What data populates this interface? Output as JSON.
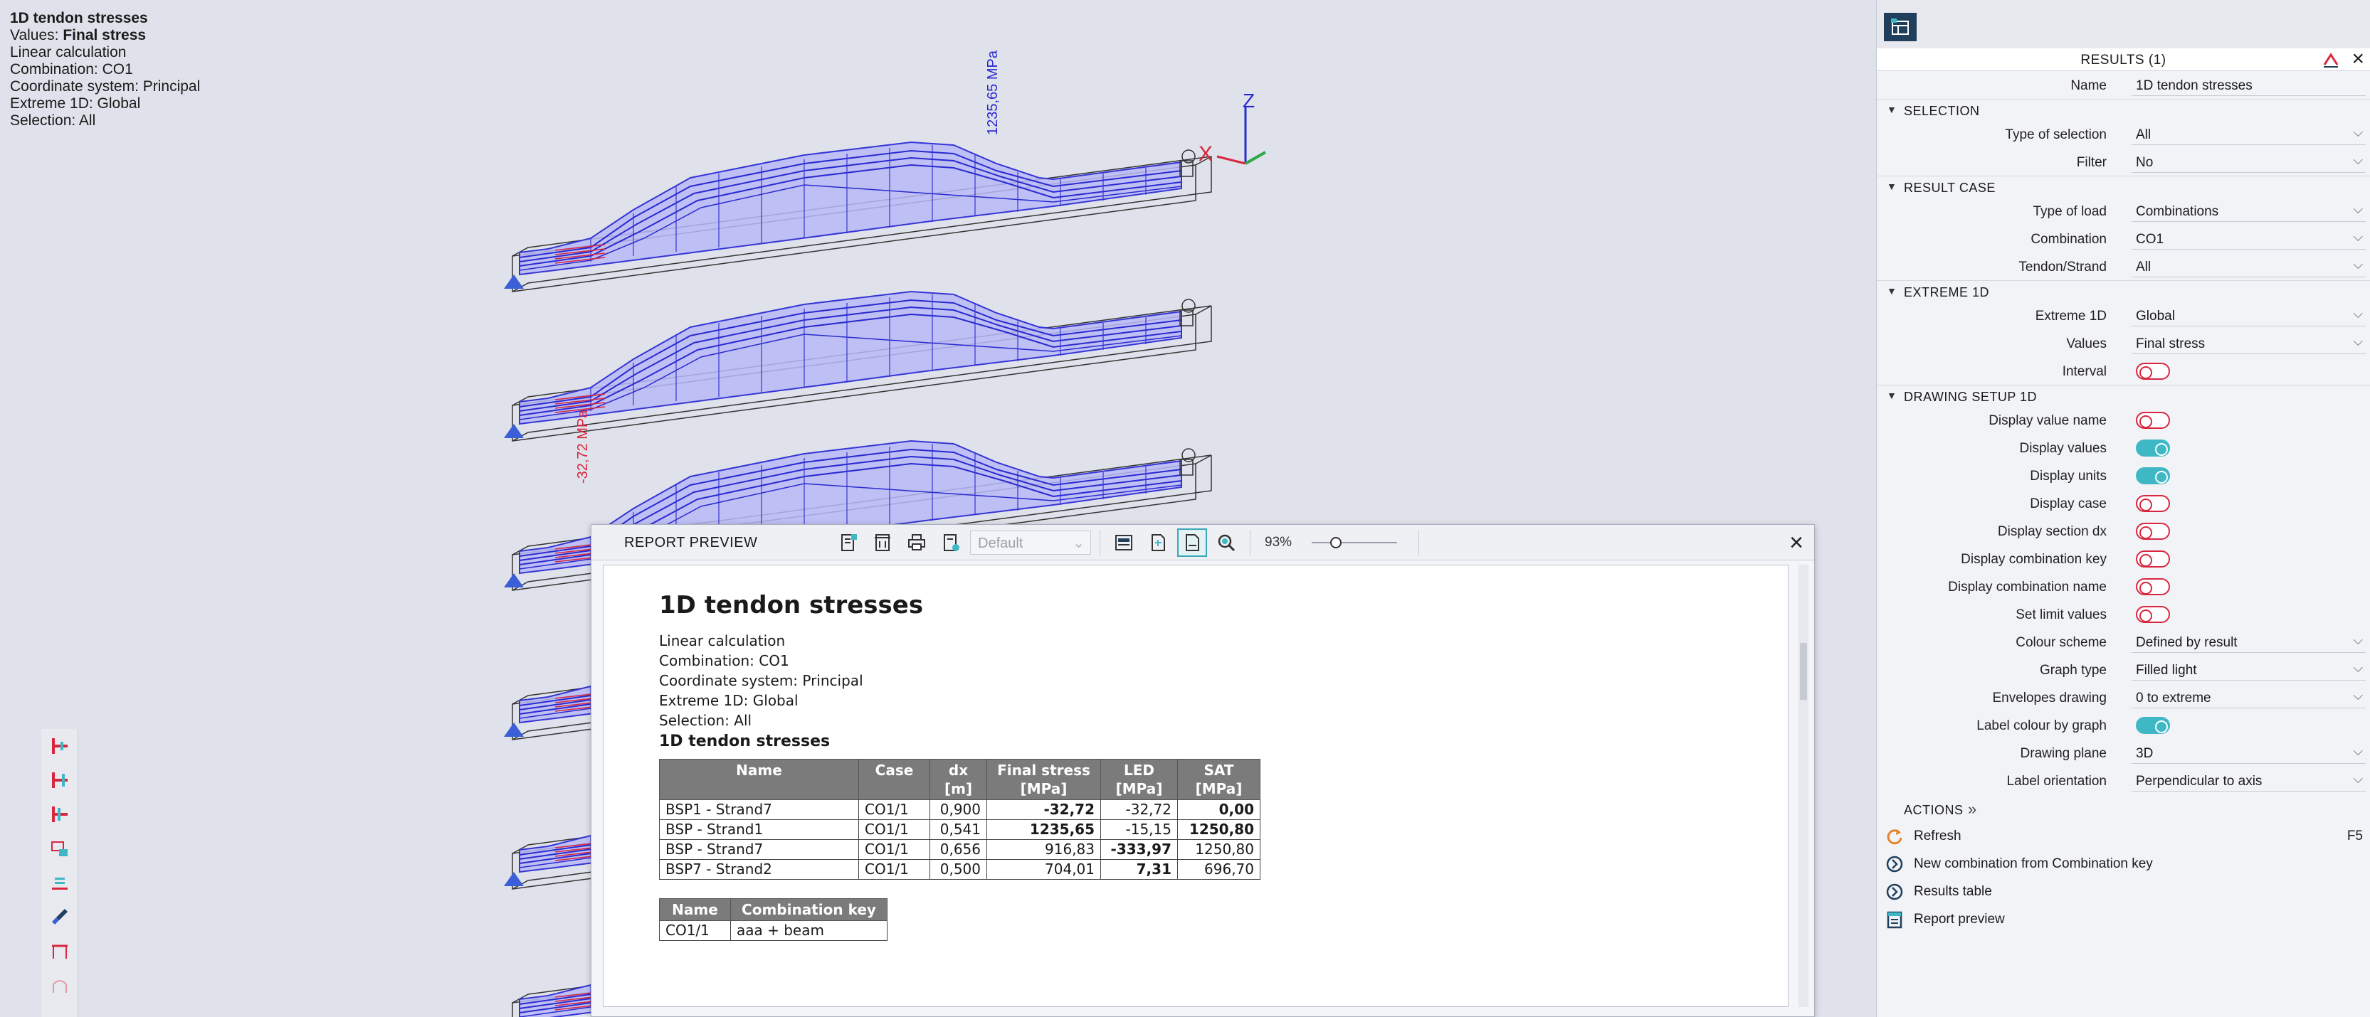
{
  "info": {
    "title": "1D tendon stresses",
    "values_prefix": "Values: ",
    "values_value": "Final stress",
    "lines": [
      "Linear calculation",
      "Combination: CO1",
      "Coordinate system: Principal",
      "Extreme 1D: Global",
      "Selection: All"
    ]
  },
  "viewport": {
    "label_max": "1235,65 MPa",
    "label_min": "-32,72 MPa",
    "axis_z": "Z",
    "axis_x": "X"
  },
  "report": {
    "title": "REPORT PREVIEW",
    "template_placeholder": "Default",
    "zoom": "93%",
    "doc": {
      "title": "1D tendon stresses",
      "lines": [
        "Linear  calculation",
        "Combination:  CO1",
        "Coordinate  system: Principal",
        "Extreme  1D: Global",
        "Selection:  All"
      ],
      "subtitle": "1D tendon stresses",
      "table": {
        "headers": [
          {
            "top": "Name",
            "unit": ""
          },
          {
            "top": "Case",
            "unit": ""
          },
          {
            "top": "dx",
            "unit": "[m]"
          },
          {
            "top": "Final stress",
            "unit": "[MPa]"
          },
          {
            "top": "LED",
            "unit": "[MPa]"
          },
          {
            "top": "SAT",
            "unit": "[MPa]"
          }
        ],
        "rows": [
          {
            "name": "BSP1 - Strand7",
            "case": "CO1/1",
            "dx": "0,900",
            "final": "-32,72",
            "led": "-32,72",
            "sat": "0,00",
            "bold": [
              "final",
              "sat"
            ]
          },
          {
            "name": "BSP - Strand1",
            "case": "CO1/1",
            "dx": "0,541",
            "final": "1235,65",
            "led": "-15,15",
            "sat": "1250,80",
            "bold": [
              "final",
              "sat"
            ]
          },
          {
            "name": "BSP - Strand7",
            "case": "CO1/1",
            "dx": "0,656",
            "final": "916,83",
            "led": "-333,97",
            "sat": "1250,80",
            "bold": [
              "led"
            ]
          },
          {
            "name": "BSP7 - Strand2",
            "case": "CO1/1",
            "dx": "0,500",
            "final": "704,01",
            "led": "7,31",
            "sat": "696,70",
            "bold": [
              "led"
            ]
          }
        ]
      },
      "combo_table": {
        "headers": [
          "Name",
          "Combination  key"
        ],
        "rows": [
          [
            "CO1/1",
            "aaa + beam"
          ]
        ]
      }
    }
  },
  "panel": {
    "title": "RESULTS (1)",
    "name_label": "Name",
    "name_value": "1D tendon stresses",
    "sections": {
      "selection": {
        "title": "SELECTION",
        "rows": [
          {
            "label": "Type of selection",
            "value": "All"
          },
          {
            "label": "Filter",
            "value": "No"
          }
        ]
      },
      "result_case": {
        "title": "RESULT CASE",
        "rows": [
          {
            "label": "Type of load",
            "value": "Combinations"
          },
          {
            "label": "Combination",
            "value": "CO1"
          },
          {
            "label": "Tendon/Strand",
            "value": "All"
          }
        ]
      },
      "extreme": {
        "title": "EXTREME 1D",
        "rows": [
          {
            "label": "Extreme 1D",
            "value": "Global"
          },
          {
            "label": "Values",
            "value": "Final stress"
          },
          {
            "label": "Interval",
            "toggle": false
          }
        ]
      },
      "drawing": {
        "title": "DRAWING SETUP 1D",
        "rows": [
          {
            "label": "Display value name",
            "toggle": false
          },
          {
            "label": "Display values",
            "toggle": true
          },
          {
            "label": "Display units",
            "toggle": true
          },
          {
            "label": "Display case",
            "toggle": false
          },
          {
            "label": "Display section dx",
            "toggle": false
          },
          {
            "label": "Display combination key",
            "toggle": false
          },
          {
            "label": "Display combination name",
            "toggle": false
          },
          {
            "label": "Set limit values",
            "toggle": false
          },
          {
            "label": "Colour scheme",
            "value": "Defined by result"
          },
          {
            "label": "Graph type",
            "value": "Filled light"
          },
          {
            "label": "Envelopes drawing",
            "value": "0 to extreme"
          },
          {
            "label": "Label colour by graph",
            "toggle": true
          },
          {
            "label": "Drawing plane",
            "value": "3D"
          },
          {
            "label": "Label orientation",
            "value": "Perpendicular to axis"
          }
        ]
      }
    },
    "actions": {
      "title": "ACTIONS",
      "items": [
        {
          "label": "Refresh",
          "key": "F5"
        },
        {
          "label": "New combination from Combination key",
          "key": ""
        },
        {
          "label": "Results table",
          "key": ""
        },
        {
          "label": "Report preview",
          "key": ""
        }
      ]
    }
  }
}
